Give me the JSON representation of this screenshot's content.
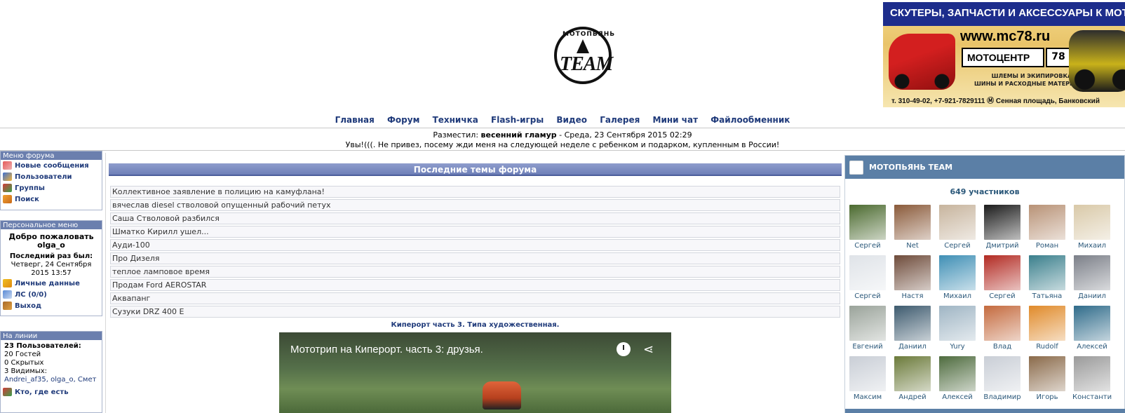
{
  "logo": {
    "arc_text": "МОТОПЬЯНЬ",
    "team_text": "TEAM"
  },
  "banner": {
    "headline": "СКУТЕРЫ, ЗАПЧАСТИ И АКСЕССУАРЫ К МОТОТЕХНИКЕ",
    "url": "www.mc78.ru",
    "brand": "МОТОЦЕНТР",
    "region": "78",
    "sub1": "ШЛЕМЫ И ЭКИПИРОВКА",
    "sub2": "ШИНЫ И РАСХОДНЫЕ МАТЕРИАЛЫ",
    "contacts": "т. 310-49-02,  +7-921-7829111   Ⓜ Сенная площадь,  Банковский"
  },
  "nav": [
    "Главная",
    "Форум",
    "Техничка",
    "Flash-игры",
    "Видео",
    "Галерея",
    "Мини чат",
    "Файлообменник"
  ],
  "post": {
    "posted_label": "Разместил:",
    "author": "весенний гламур",
    "date": " - Среда, 23 Сентября 2015 02:29",
    "text": "Увы!(((. Не привез, посему жди меня на следующей неделе с ребенком и подарком, купленным в России!"
  },
  "forum_menu": {
    "title": "Меню форума",
    "items": [
      "Новые сообщения",
      "Пользователи",
      "Группы",
      "Поиск"
    ]
  },
  "personal_menu": {
    "title": "Персональное меню",
    "welcome": "Добро пожаловать",
    "username": "olga_o",
    "last_visit_label": "Последний раз был:",
    "last_visit": "Четверг, 24 Сентября 2015 13:57",
    "items": [
      "Личные данные",
      "ЛС (0/0)",
      "Выход"
    ]
  },
  "online": {
    "title": "На линии",
    "users_label": "23 Пользователей:",
    "guests": "20  Гостей",
    "hidden": "0  Скрытых",
    "visible": "3  Видимых:",
    "names": "Andrei_af35, olga_o, Смет",
    "who_link": "Кто, где есть"
  },
  "main": {
    "header": "Последние темы форума",
    "topics": [
      "Коллективное заявление в полицию на камуфлана!",
      "вячеслав diesel стволовой опущенный рабочий петух",
      "Саша Стволовой разбился",
      "Шматко Кирилл ушел...",
      "Ауди-100",
      "Про Дизеля",
      "теплое ламповое время",
      "Продам Ford AEROSTAR",
      "Аквапанг",
      "Сузуки DRZ 400 E"
    ],
    "video_caption": "Кипероpт часть 3. Типа художественная.",
    "video_title": "Мототрип на Кипероpт. часть 3: друзья."
  },
  "vk": {
    "title": "МОТОПЬЯНЬ TEAM",
    "members_count": "649 участников",
    "members": [
      {
        "name": "Сергей",
        "color": "#4b6a2f"
      },
      {
        "name": "Net",
        "color": "#8a5a3a"
      },
      {
        "name": "Сергей",
        "color": "#c7b49d"
      },
      {
        "name": "Дмитрий",
        "color": "#1b1b1b"
      },
      {
        "name": "Роман",
        "color": "#b89276"
      },
      {
        "name": "Михаил",
        "color": "#d9c9a8"
      },
      {
        "name": "Сергей",
        "color": "#dfe3e8"
      },
      {
        "name": "Настя",
        "color": "#6e4b3a"
      },
      {
        "name": "Михаил",
        "color": "#3f8fb5"
      },
      {
        "name": "Сергей",
        "color": "#b22a22"
      },
      {
        "name": "Татьяна",
        "color": "#3a7f8c"
      },
      {
        "name": "Даниил",
        "color": "#7b7f88"
      },
      {
        "name": "Евгений",
        "color": "#9aa39a"
      },
      {
        "name": "Даниил",
        "color": "#3d5a6e"
      },
      {
        "name": "Yury",
        "color": "#9fb5c4"
      },
      {
        "name": "Влад",
        "color": "#c46a3e"
      },
      {
        "name": "Rudolf",
        "color": "#e08a2a"
      },
      {
        "name": "Алексей",
        "color": "#2f6b8a"
      },
      {
        "name": "Максим",
        "color": "#c9ced6"
      },
      {
        "name": "Андрей",
        "color": "#6b7a3a"
      },
      {
        "name": "Алексей",
        "color": "#4e6b3e"
      },
      {
        "name": "Владимир",
        "color": "#c9ced6"
      },
      {
        "name": "Игорь",
        "color": "#8a6a4a"
      },
      {
        "name": "Константин",
        "color": "#9a9a9a"
      }
    ]
  }
}
